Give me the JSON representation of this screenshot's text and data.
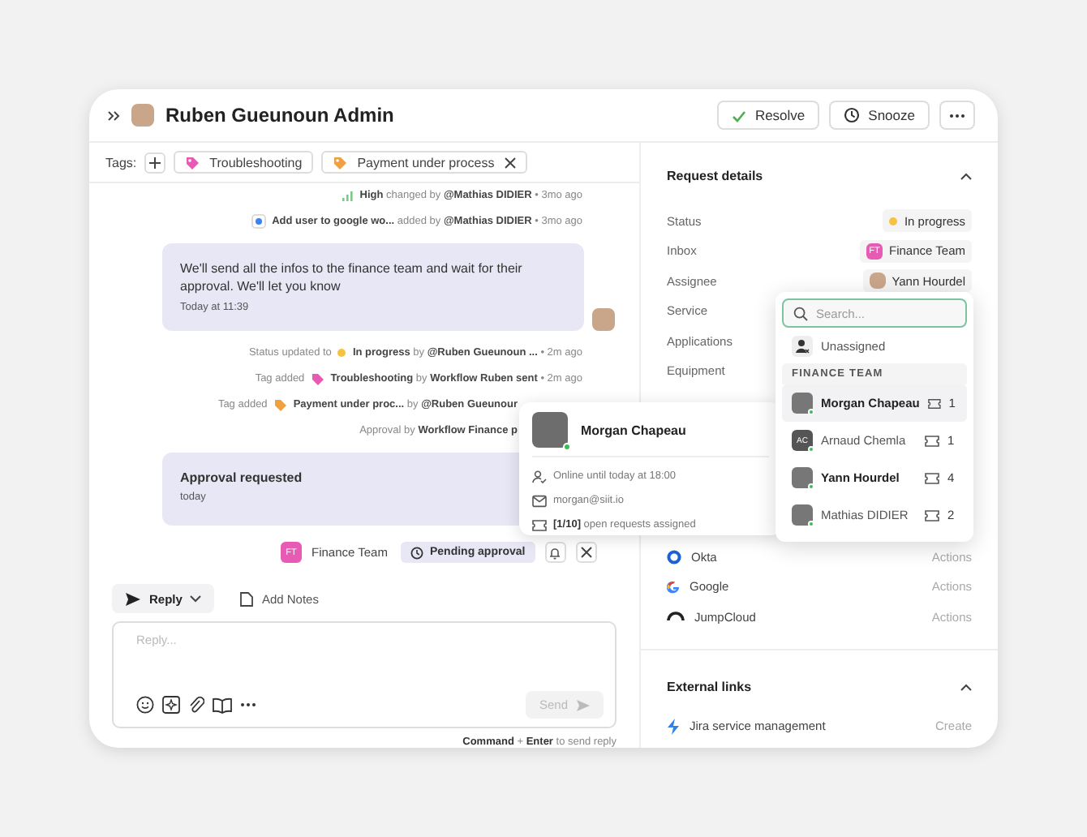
{
  "header": {
    "title": "Ruben Gueunoun Admin",
    "actions": [
      {
        "kind": "resolve",
        "label": "Resolve"
      },
      {
        "kind": "snooze",
        "label": "Snooze"
      },
      {
        "kind": "more"
      }
    ]
  },
  "tags": {
    "label": "Tags:",
    "items": [
      {
        "label": "Troubleshooting",
        "color": "#e85bb5",
        "removable": false
      },
      {
        "label": "Payment under process",
        "color": "#f0a040",
        "removable": true
      }
    ]
  },
  "feed": [
    {
      "kind": "priority_event",
      "text": "**High** changed by **@Mathias DIDIER** • 3mo ago"
    },
    {
      "kind": "app_event",
      "text": "**Add user to google wo...** added by **@Mathias DIDIER** • 3mo ago"
    },
    {
      "kind": "message",
      "text": "We'll send all the infos to the finance team and wait for their approval. We'll let you know",
      "time": "Today at 11:39"
    },
    {
      "kind": "status_event",
      "lead": "Status updated to",
      "color": "#f5c242",
      "text": "**In progress** by **@Ruben Gueunoun ...** • 2m ago"
    },
    {
      "kind": "tag_event",
      "lead": "Tag added",
      "color": "#e85bb5",
      "text": "**Troubleshooting** by **Workflow Ruben sent** • 2m ago"
    },
    {
      "kind": "tag_event",
      "lead": "Tag added",
      "color": "#f0a040",
      "text": "**Payment under proc...**  by **@Ruben Gueunour**",
      "covered": true
    },
    {
      "kind": "note_event",
      "text": "Approval by **Workflow Finance p**",
      "covered": true
    },
    {
      "kind": "approval",
      "title": "Approval requested",
      "time": "today"
    },
    {
      "kind": "approval_bar",
      "initials": "FT",
      "team": "Finance Team",
      "status": "Pending approval"
    }
  ],
  "composer": {
    "modes": [
      {
        "kind": "reply",
        "label": "Reply",
        "selected": true
      },
      {
        "kind": "notes",
        "label": "Add Notes",
        "selected": false
      }
    ],
    "placeholder": "Reply...",
    "send": "Send",
    "send_disabled": true,
    "hint": "**Command** + **Enter** to send reply"
  },
  "details": {
    "title": "Request details",
    "expanded": true,
    "fields": [
      {
        "label": "Status",
        "kind": "status",
        "value": "In progress",
        "color": "#f5c242"
      },
      {
        "label": "Inbox",
        "kind": "team",
        "value": "Finance Team",
        "initials": "FT"
      },
      {
        "label": "Assignee",
        "kind": "user",
        "value": "Yann Hourdel"
      },
      {
        "label": "Service",
        "kind": "empty"
      },
      {
        "label": "Applications",
        "kind": "empty"
      },
      {
        "label": "Equipment",
        "kind": "empty"
      }
    ],
    "apps": [
      {
        "kind": "okta",
        "name": "Okta",
        "action": "Actions"
      },
      {
        "kind": "google",
        "name": "Google",
        "action": "Actions"
      },
      {
        "kind": "jumpcloud",
        "name": "JumpCloud",
        "action": "Actions"
      }
    ]
  },
  "external_links": {
    "title": "External links",
    "expanded": true,
    "items": [
      {
        "kind": "jira",
        "name": "Jira service management",
        "action": "Create"
      }
    ]
  },
  "assignee_dropdown": {
    "placeholder": "Search...",
    "unassigned": "Unassigned",
    "group": "FINANCE TEAM",
    "people": [
      {
        "name": "Morgan Chapeau",
        "count": "1",
        "selected": true,
        "assigned": false,
        "online": true
      },
      {
        "name": "Arnaud Chemla",
        "initials": "AC",
        "count": "1",
        "selected": false,
        "assigned": false,
        "online": true
      },
      {
        "name": "Yann Hourdel",
        "count": "4",
        "selected": false,
        "assigned": true,
        "online": true
      },
      {
        "name": "Mathias DIDIER",
        "count": "2",
        "selected": false,
        "assigned": false,
        "online": true
      }
    ]
  },
  "profile_card": {
    "name": "Morgan Chapeau",
    "online": true,
    "availability": "Online until today at 18:00",
    "email": "morgan@siit.io",
    "requests": "**[1/10]** open requests assigned"
  }
}
